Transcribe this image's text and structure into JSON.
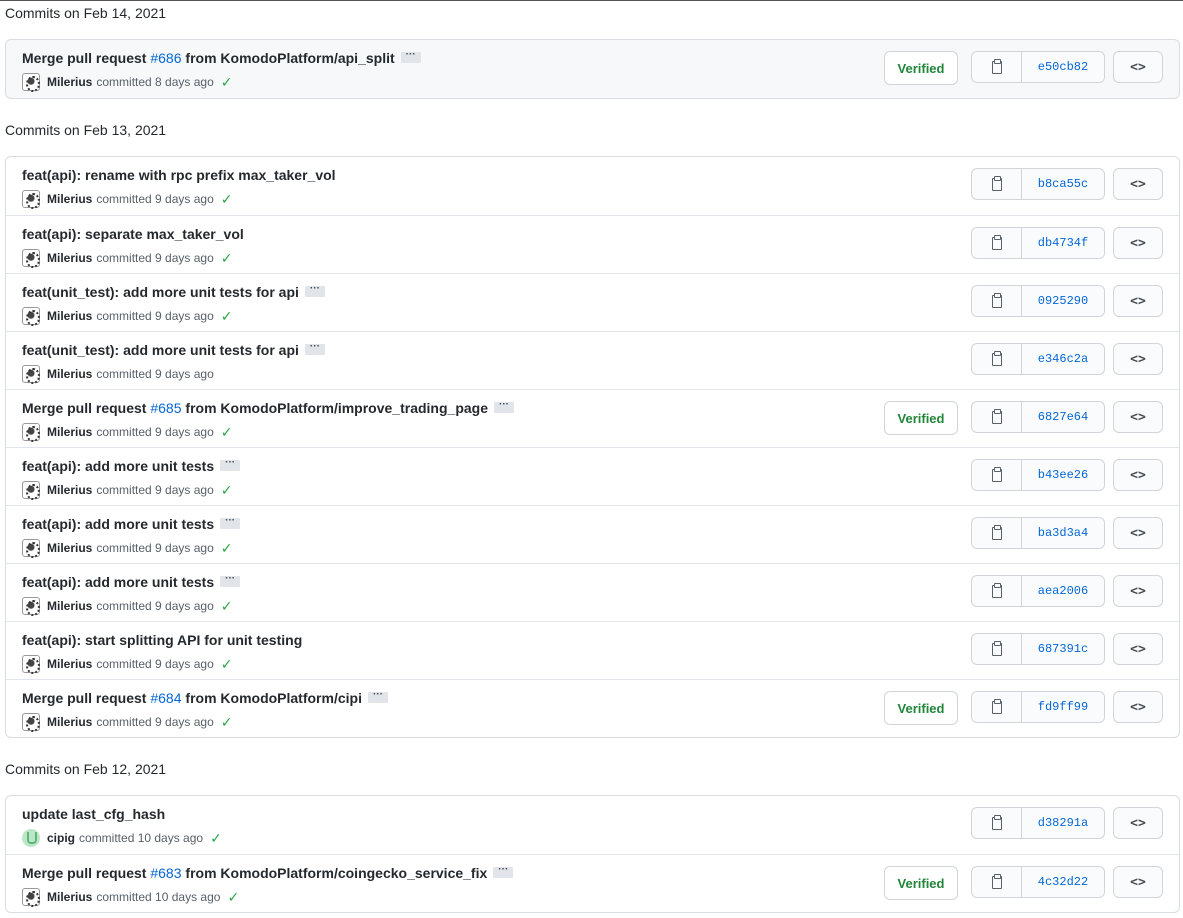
{
  "groups": [
    {
      "date_label": "Commits on Feb 14, 2021",
      "commits": [
        {
          "title_pre": "Merge pull request ",
          "pr": "#686",
          "title_post": " from KomodoPlatform/api_split",
          "ellipsis": true,
          "author": "Milerius",
          "avatar": "milerius",
          "time": "committed 8 days ago",
          "check": true,
          "verified": "Verified",
          "sha": "e50cb82"
        }
      ]
    },
    {
      "date_label": "Commits on Feb 13, 2021",
      "commits": [
        {
          "title_pre": "feat(api): rename with rpc prefix max_taker_vol",
          "pr": "",
          "title_post": "",
          "ellipsis": false,
          "author": "Milerius",
          "avatar": "milerius",
          "time": "committed 9 days ago",
          "check": true,
          "verified": "",
          "sha": "b8ca55c"
        },
        {
          "title_pre": "feat(api): separate max_taker_vol",
          "pr": "",
          "title_post": "",
          "ellipsis": false,
          "author": "Milerius",
          "avatar": "milerius",
          "time": "committed 9 days ago",
          "check": true,
          "verified": "",
          "sha": "db4734f"
        },
        {
          "title_pre": "feat(unit_test): add more unit tests for api",
          "pr": "",
          "title_post": "",
          "ellipsis": true,
          "author": "Milerius",
          "avatar": "milerius",
          "time": "committed 9 days ago",
          "check": true,
          "verified": "",
          "sha": "0925290"
        },
        {
          "title_pre": "feat(unit_test): add more unit tests for api",
          "pr": "",
          "title_post": "",
          "ellipsis": true,
          "author": "Milerius",
          "avatar": "milerius",
          "time": "committed 9 days ago",
          "check": false,
          "verified": "",
          "sha": "e346c2a"
        },
        {
          "title_pre": "Merge pull request ",
          "pr": "#685",
          "title_post": " from KomodoPlatform/improve_trading_page",
          "ellipsis": true,
          "author": "Milerius",
          "avatar": "milerius",
          "time": "committed 9 days ago",
          "check": true,
          "verified": "Verified",
          "sha": "6827e64"
        },
        {
          "title_pre": "feat(api): add more unit tests",
          "pr": "",
          "title_post": "",
          "ellipsis": true,
          "author": "Milerius",
          "avatar": "milerius",
          "time": "committed 9 days ago",
          "check": true,
          "verified": "",
          "sha": "b43ee26"
        },
        {
          "title_pre": "feat(api): add more unit tests",
          "pr": "",
          "title_post": "",
          "ellipsis": true,
          "author": "Milerius",
          "avatar": "milerius",
          "time": "committed 9 days ago",
          "check": true,
          "verified": "",
          "sha": "ba3d3a4"
        },
        {
          "title_pre": "feat(api): add more unit tests",
          "pr": "",
          "title_post": "",
          "ellipsis": true,
          "author": "Milerius",
          "avatar": "milerius",
          "time": "committed 9 days ago",
          "check": true,
          "verified": "",
          "sha": "aea2006"
        },
        {
          "title_pre": "feat(api): start splitting API for unit testing",
          "pr": "",
          "title_post": "",
          "ellipsis": false,
          "author": "Milerius",
          "avatar": "milerius",
          "time": "committed 9 days ago",
          "check": true,
          "verified": "",
          "sha": "687391c"
        },
        {
          "title_pre": "Merge pull request ",
          "pr": "#684",
          "title_post": " from KomodoPlatform/cipi",
          "ellipsis": true,
          "author": "Milerius",
          "avatar": "milerius",
          "time": "committed 9 days ago",
          "check": true,
          "verified": "Verified",
          "sha": "fd9ff99"
        }
      ]
    },
    {
      "date_label": "Commits on Feb 12, 2021",
      "commits": [
        {
          "title_pre": "update last_cfg_hash",
          "pr": "",
          "title_post": "",
          "ellipsis": false,
          "author": "cipig",
          "avatar": "cipig",
          "time": "committed 10 days ago",
          "check": true,
          "verified": "",
          "sha": "d38291a"
        },
        {
          "title_pre": "Merge pull request ",
          "pr": "#683",
          "title_post": " from KomodoPlatform/coingecko_service_fix",
          "ellipsis": true,
          "author": "Milerius",
          "avatar": "milerius",
          "time": "committed 10 days ago",
          "check": true,
          "verified": "Verified",
          "sha": "4c32d22"
        }
      ]
    }
  ],
  "icons": {
    "ellipsis": "···",
    "check": "✓",
    "browse": "<>"
  }
}
